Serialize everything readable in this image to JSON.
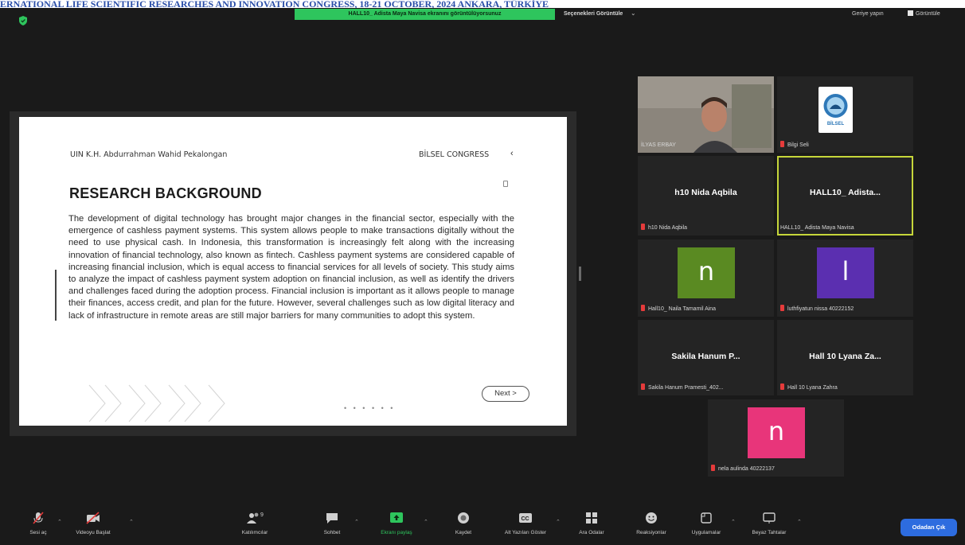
{
  "banner": {
    "text": "ERNATIONAL LIFE SCIENTIFIC RESEARCHES AND INNOVATION CONGRESS, 18-21 OCTOBER, 2024 ANKARA, TÜRKİYE"
  },
  "topbar": {
    "share_status": "HALL10_ Adista Maya Navisa ekranını görüntülüyorsunuz",
    "view_options": "Seçenekleri Görüntüle",
    "exit_fullscreen": "Geriye yapın",
    "view": "Görüntüle"
  },
  "slide": {
    "institution": "UIN K.H. Abdurrahman Wahid Pekalongan",
    "conference": "BİLSEL CONGRESS",
    "title": "RESEARCH BACKGROUND",
    "body": "The development of digital technology has brought major changes in the financial sector, especially with the emergence of cashless payment systems. This system allows people to make transactions digitally without the need to use physical cash. In Indonesia, this transformation is increasingly felt along with the increasing innovation of financial technology, also known as fintech. Cashless payment systems are considered capable of increasing financial inclusion, which is equal access to financial services for all levels of society. This study aims to analyze the impact of cashless payment system adoption on financial inclusion, as well as identify the drivers and challenges faced during the adoption process. Financial inclusion is important as it allows people to manage their finances, access credit, and plan for the future. However, several challenges such as low digital literacy and lack of infrastructure in remote areas are still major barriers for many communities to adopt this system.",
    "next_label": "Next >",
    "dots": "• • • • • •"
  },
  "participants": [
    {
      "id": "ilyas",
      "label": "İLYAS ERBAY",
      "type": "video"
    },
    {
      "id": "bilgi",
      "label": "Bilgi Seli",
      "type": "logo",
      "logo_text": "BİLSEL"
    },
    {
      "id": "nida",
      "label": "h10 Nida Aqbila",
      "display": "h10 Nida Aqbila",
      "type": "name"
    },
    {
      "id": "adista",
      "label": "HALL10_ Adista Maya Navisa",
      "display": "HALL10_ Adista...",
      "type": "name",
      "active": true
    },
    {
      "id": "naila",
      "label": "Hall10_ Naila Tamamil Aina",
      "type": "avatar",
      "letter": "n",
      "color": "#5a8a22"
    },
    {
      "id": "luthfiyatun",
      "label": "luthfiyatun nissa 40222152",
      "type": "avatar",
      "letter": "l",
      "color": "#5b2fb0"
    },
    {
      "id": "sakila",
      "label": "Sakila Hanum Pramesti_402...",
      "display": "Sakila Hanum P...",
      "type": "name"
    },
    {
      "id": "lyana",
      "label": "Hall 10 Lyana Zahra",
      "display": "Hall 10 Lyana Za...",
      "type": "name"
    },
    {
      "id": "nela",
      "label": "nela aulinda 40222137",
      "type": "avatar",
      "letter": "n",
      "color": "#e8357a"
    }
  ],
  "toolbar": {
    "unmute": "Sesi aç",
    "start_video": "Videoyu Başlat",
    "participants": "Katılımcılar",
    "participants_count": "9",
    "chat": "Sohbet",
    "share_screen": "Ekranı paylaş",
    "record": "Kaydet",
    "captions": "Alt Yazıları Göster",
    "breakout": "Ara Odalar",
    "reactions": "Reaksiyonlar",
    "apps": "Uygulamalar",
    "whiteboard": "Beyaz Tahtalar",
    "leave": "Odadan Çık"
  },
  "colors": {
    "share_green": "#2ec55d",
    "leave_blue": "#2d6cdf",
    "active_border": "#c6d63a",
    "muted_red": "#e53b3b"
  }
}
